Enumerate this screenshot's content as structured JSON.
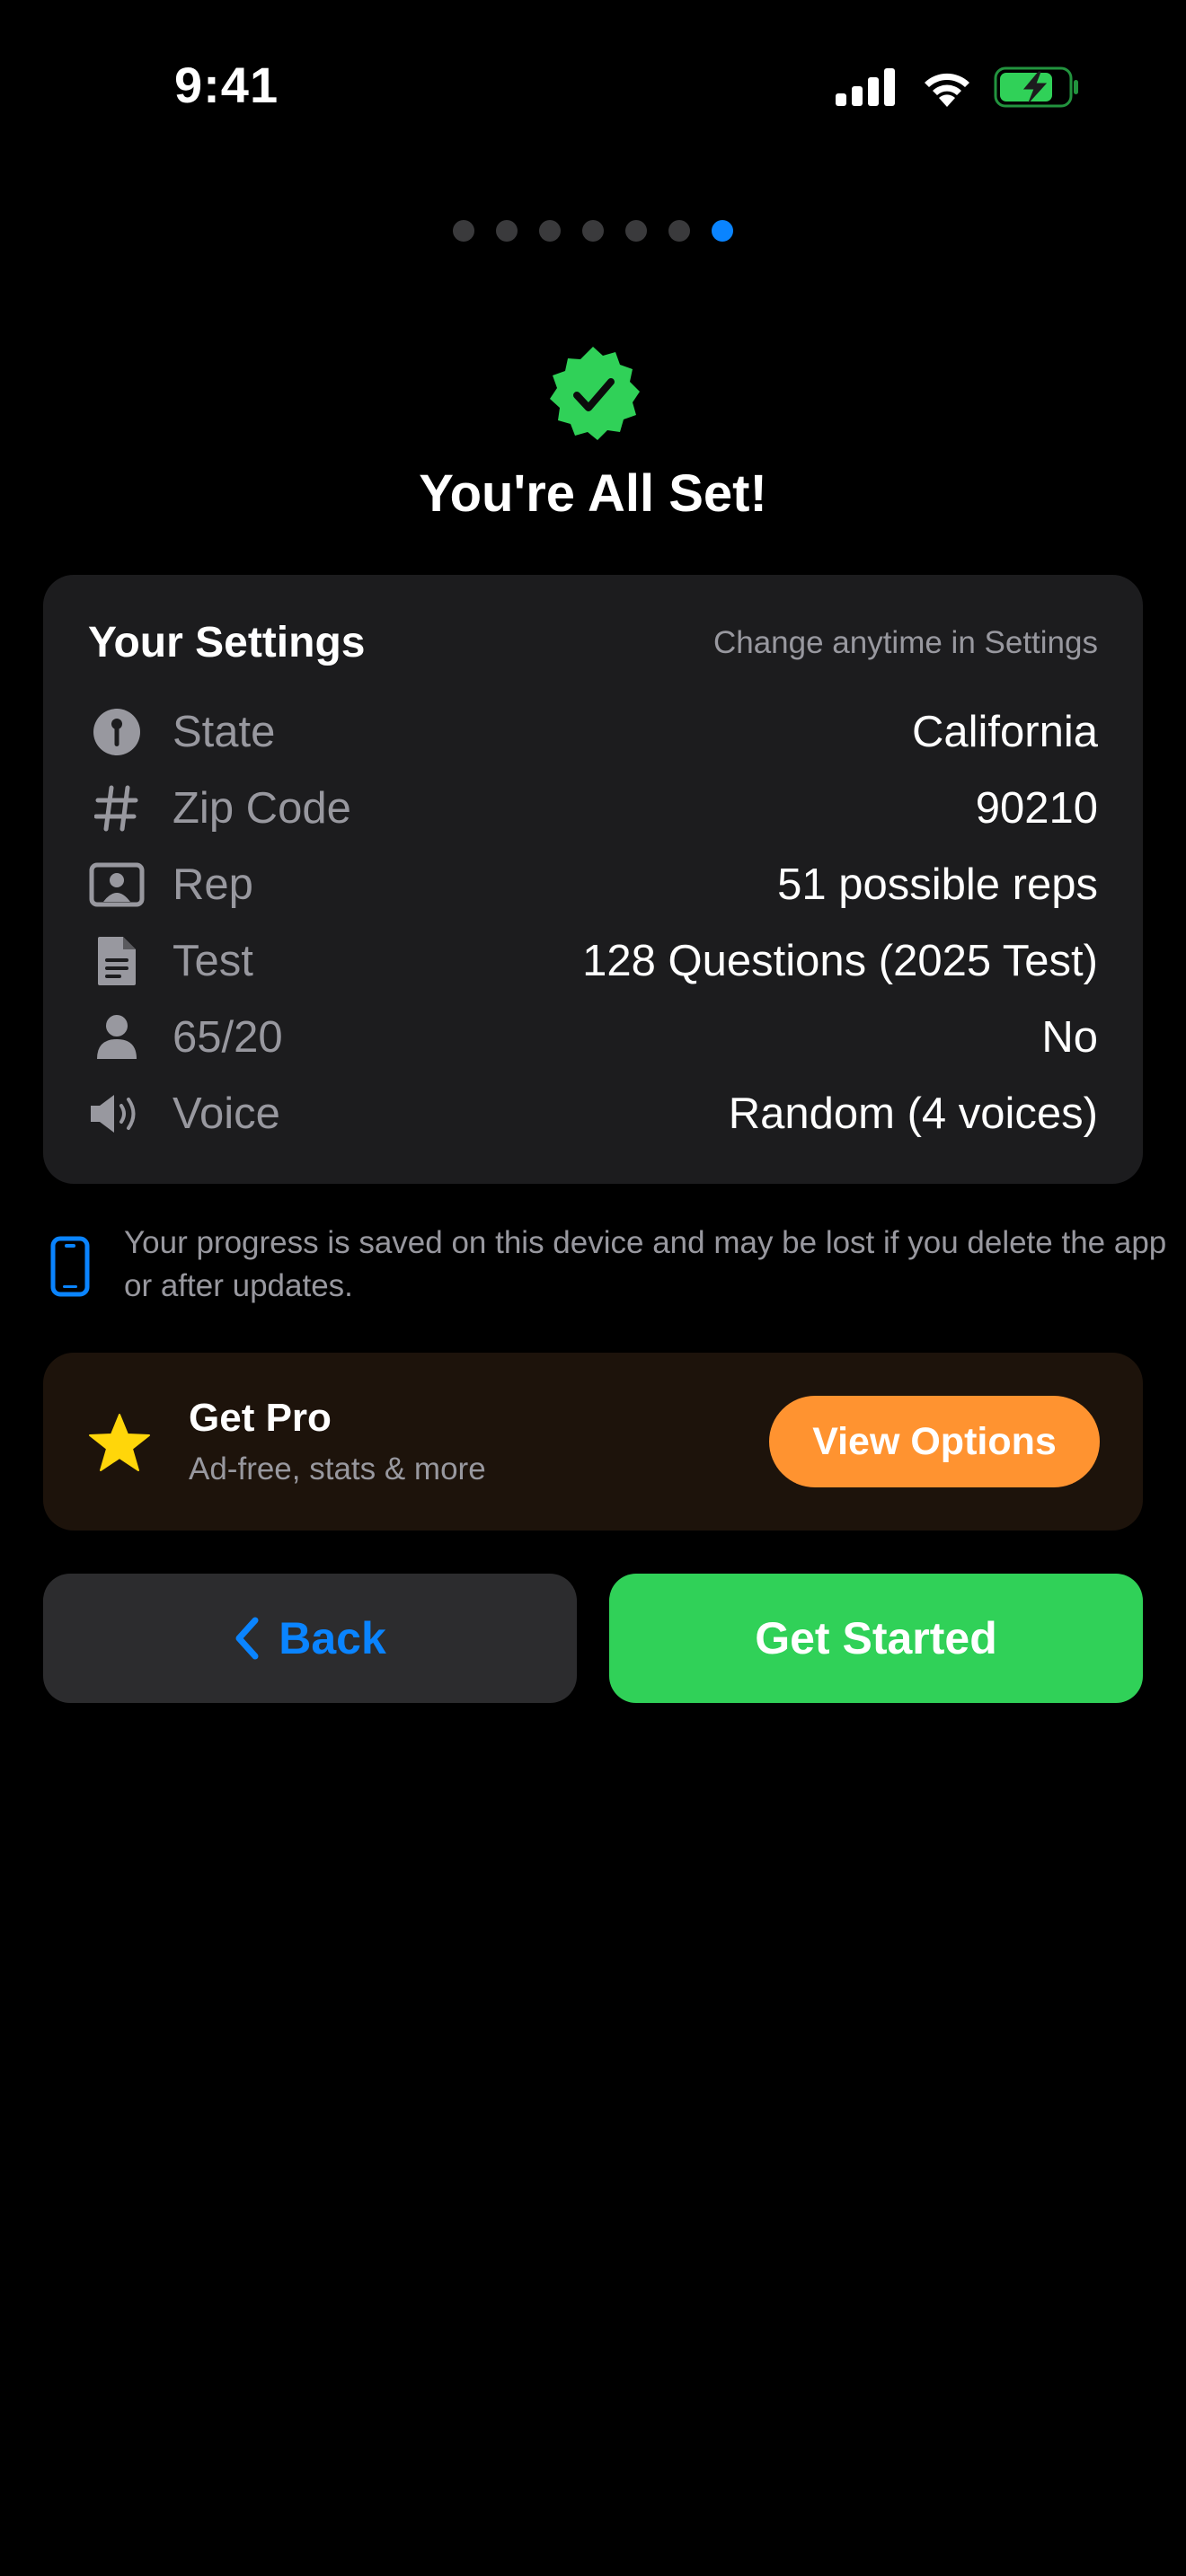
{
  "status_bar": {
    "time": "9:41",
    "icons": [
      "signal-icon",
      "wifi-icon",
      "battery-charging-icon"
    ],
    "battery_color": "#30d158"
  },
  "onboarding": {
    "page_count": 7,
    "current_page": 7,
    "active_dot_color": "#0a84ff"
  },
  "hero": {
    "icon": "check-badge-icon",
    "icon_color": "#30d158",
    "title": "You're All Set!"
  },
  "settings_card": {
    "title": "Your Settings",
    "hint": "Change anytime in Settings",
    "rows": [
      {
        "icon": "info-pin-icon",
        "label": "State",
        "value": "California"
      },
      {
        "icon": "hashtag-icon",
        "label": "Zip Code",
        "value": "90210"
      },
      {
        "icon": "person-card-icon",
        "label": "Rep",
        "value": "51 possible reps"
      },
      {
        "icon": "document-icon",
        "label": "Test",
        "value": "128 Questions (2025 Test)"
      },
      {
        "icon": "person-icon",
        "label": "65/20",
        "value": "No"
      },
      {
        "icon": "speaker-icon",
        "label": "Voice",
        "value": "Random (4 voices)"
      }
    ]
  },
  "notice": {
    "icon": "phone-icon",
    "text": "Your progress is saved on this device and may be lost if you delete the app or after updates."
  },
  "pro": {
    "icon": "star-icon",
    "title": "Get Pro",
    "subtitle": "Ad-free, stats & more",
    "button_label": "View Options",
    "accent": "#ff9330"
  },
  "actions": {
    "back_label": "Back",
    "start_label": "Get Started",
    "back_color": "#0a84ff",
    "start_color": "#30d158"
  }
}
